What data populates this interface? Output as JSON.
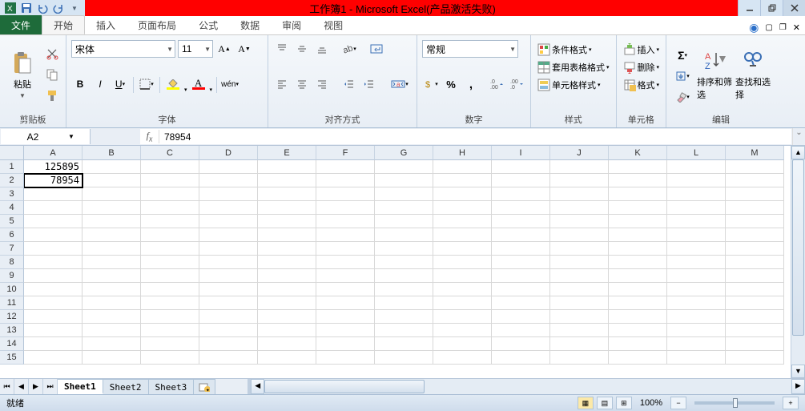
{
  "title": "工作簿1 - Microsoft Excel(产品激活失败)",
  "tabs": {
    "file": "文件",
    "home": "开始",
    "insert": "插入",
    "layout": "页面布局",
    "formulas": "公式",
    "data": "数据",
    "review": "审阅",
    "view": "视图"
  },
  "groups": {
    "clipboard": "剪贴板",
    "paste": "粘贴",
    "font": "字体",
    "font_name": "宋体",
    "font_size": "11",
    "align": "对齐方式",
    "number": "数字",
    "number_format": "常规",
    "styles": "样式",
    "cond_fmt": "条件格式",
    "tbl_fmt": "套用表格格式",
    "cell_style": "单元格样式",
    "cells": "单元格",
    "insert_btn": "插入",
    "delete_btn": "删除",
    "format_btn": "格式",
    "editing": "编辑",
    "sort_filter": "排序和筛选",
    "find_select": "查找和选择"
  },
  "namebox": "A2",
  "formula": "78954",
  "columns": [
    "A",
    "B",
    "C",
    "D",
    "E",
    "F",
    "G",
    "H",
    "I",
    "J",
    "K",
    "L",
    "M"
  ],
  "rows": [
    "1",
    "2",
    "3",
    "4",
    "5",
    "6",
    "7",
    "8",
    "9",
    "10",
    "11",
    "12",
    "13",
    "14",
    "15"
  ],
  "cells": {
    "A1": "125895",
    "A2": "78954"
  },
  "selected": "A2",
  "sheets": [
    "Sheet1",
    "Sheet2",
    "Sheet3"
  ],
  "status": "就绪",
  "zoom": "100%"
}
